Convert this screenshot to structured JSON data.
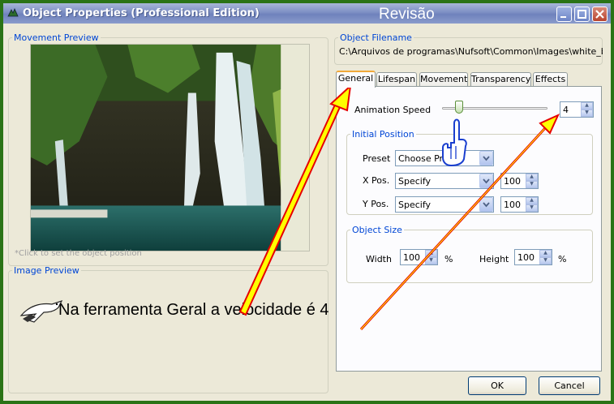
{
  "window": {
    "title": "Object Properties (Professional Edition)",
    "overlay_title": "Revisão",
    "accent": "#0046d5"
  },
  "left": {
    "movement_preview_label": "Movement Preview",
    "click_hint": "*Click to set the object position",
    "image_preview_label": "Image Preview"
  },
  "filename": {
    "label": "Object Filename",
    "value": "C:\\Arquivos de programas\\Nufsoft\\Common\\Images\\white_bird.g"
  },
  "tabs": [
    "General",
    "Lifespan",
    "Movement",
    "Transparency",
    "Effects"
  ],
  "general": {
    "animation_speed_label": "Animation Speed",
    "animation_speed_value": "4",
    "animation_speed_level": 4,
    "initial_position_label": "Initial Position",
    "preset_label": "Preset",
    "preset_value": "Choose Preset",
    "xpos_label": "X Pos.",
    "xpos_mode": "Specify",
    "xpos_value": "100",
    "ypos_label": "Y Pos.",
    "ypos_mode": "Specify",
    "ypos_value": "100",
    "object_size_label": "Object Size",
    "width_label": "Width",
    "width_value": "100",
    "width_unit": "%",
    "height_label": "Height",
    "height_value": "100",
    "height_unit": "%"
  },
  "buttons": {
    "ok": "OK",
    "cancel": "Cancel"
  },
  "annotation": {
    "text": "Na ferramenta Geral a velocidade é 4",
    "arrow_color": "#e60000",
    "arrow_fill": "#ffff00"
  }
}
